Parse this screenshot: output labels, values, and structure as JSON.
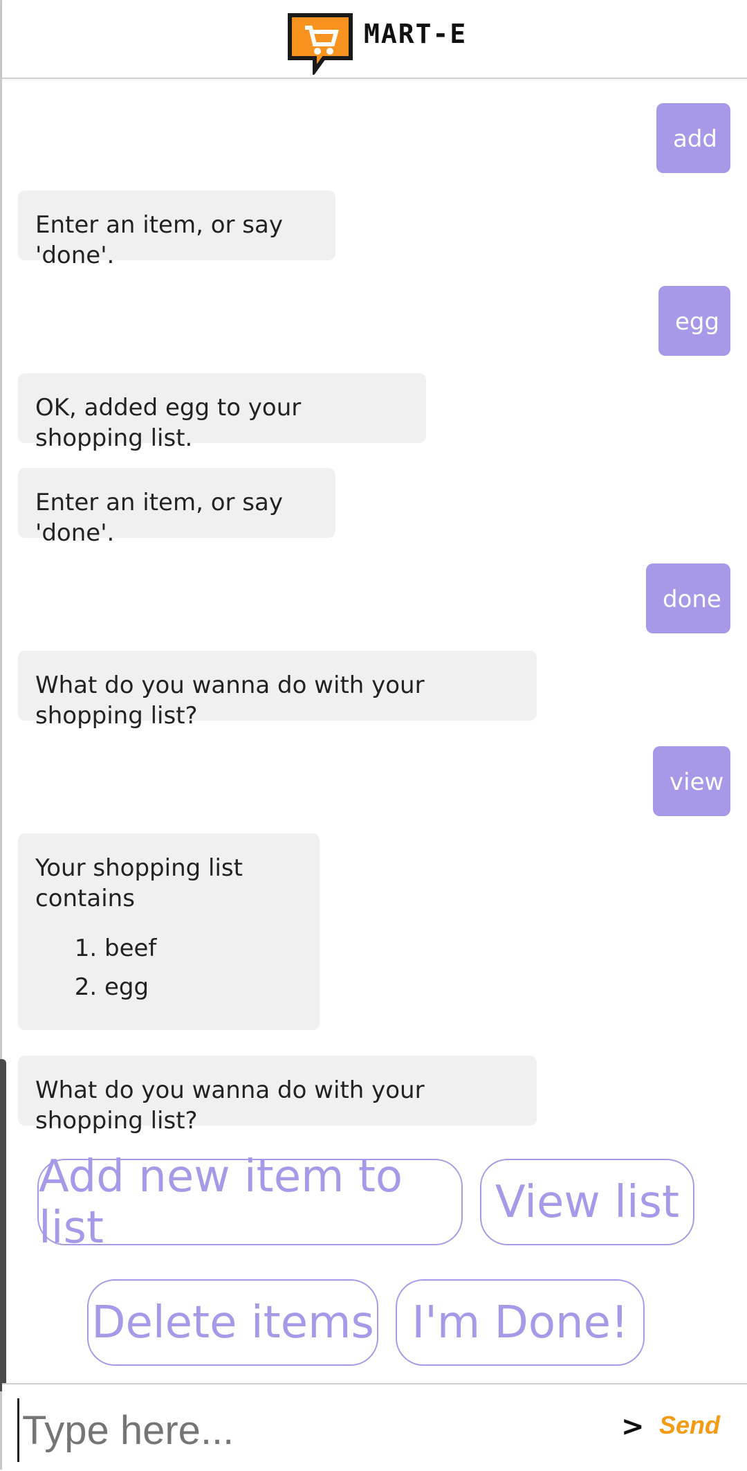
{
  "app": {
    "title": "MART-E",
    "logo_icon": "shopping-cart-speech-bubble-icon",
    "accent_color": "#a899e8",
    "logo_color": "#f7931e"
  },
  "messages": [
    {
      "from": "user",
      "text": "add"
    },
    {
      "from": "bot",
      "text": "Enter an item, or say 'done'."
    },
    {
      "from": "user",
      "text": "egg"
    },
    {
      "from": "bot",
      "text": "OK, added egg to your shopping list."
    },
    {
      "from": "bot",
      "text": "Enter an item, or say 'done'."
    },
    {
      "from": "user",
      "text": "done"
    },
    {
      "from": "bot",
      "text": "What do you wanna do with your shopping list?"
    },
    {
      "from": "user",
      "text": "view"
    },
    {
      "from": "bot",
      "text": "Your shopping list contains",
      "list": [
        "beef",
        "egg"
      ]
    },
    {
      "from": "bot",
      "text": "What do you wanna do with your shopping list?"
    }
  ],
  "quick_replies": [
    "Add new item to list",
    "View list",
    "Delete items",
    "I'm Done!"
  ],
  "composer": {
    "placeholder": "Type here...",
    "send_arrow": ">",
    "send_label": "Send"
  }
}
